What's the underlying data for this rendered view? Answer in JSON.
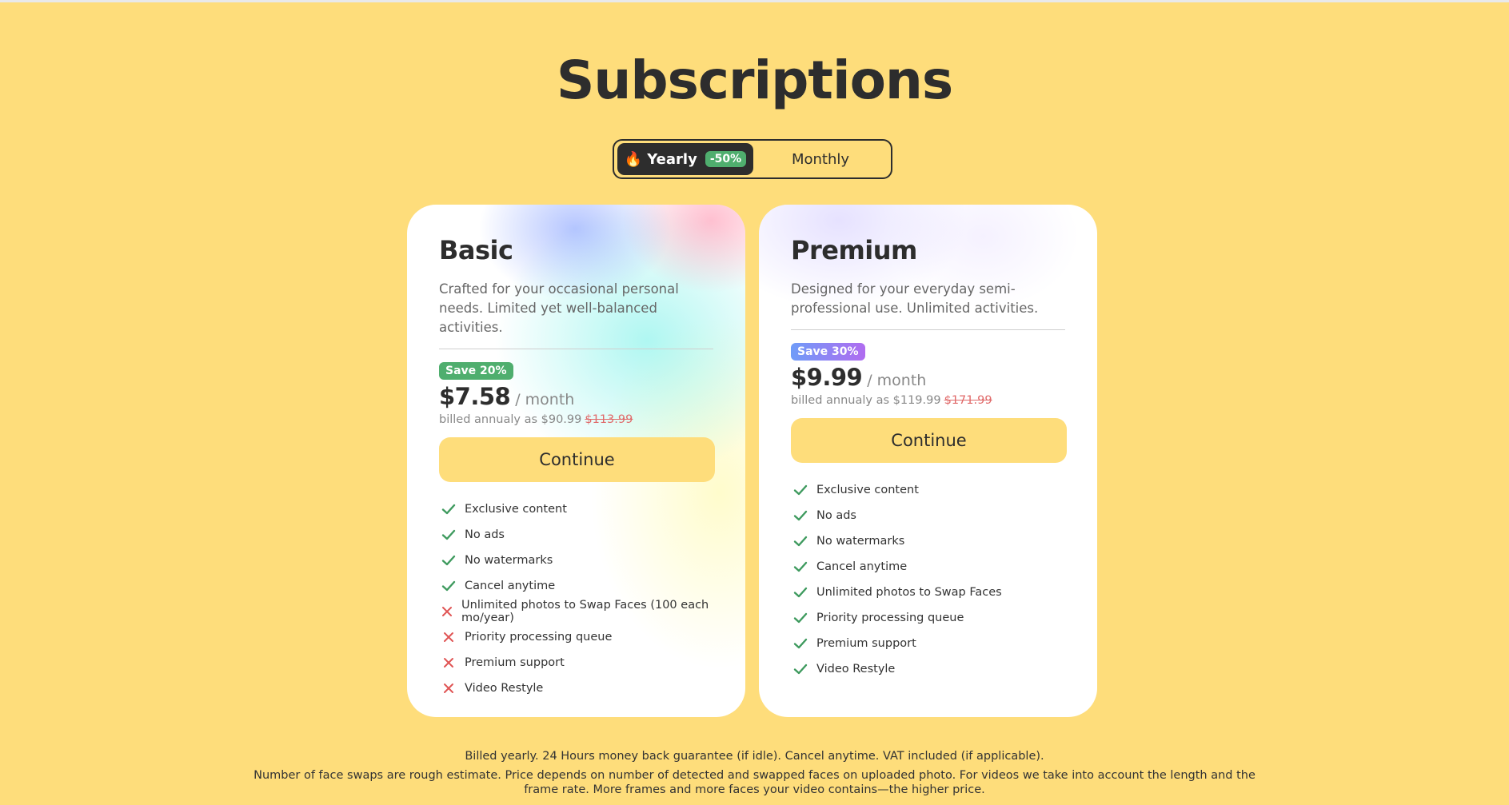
{
  "page": {
    "title": "Subscriptions"
  },
  "billing_toggle": {
    "yearly_icon": "fire-icon",
    "yearly_label": "Yearly",
    "yearly_discount": "-50%",
    "monthly_label": "Monthly",
    "selected": "Yearly"
  },
  "plans": [
    {
      "name": "Basic",
      "description": "Crafted for your occasional personal needs. Limited yet well-balanced activities.",
      "save_badge": "Save 20%",
      "price": "$7.58",
      "period": "/ month",
      "billed_text": "billed annualy as $90.99",
      "old_price": "$113.99",
      "cta": "Continue",
      "features": [
        {
          "label": "Exclusive content",
          "included": true
        },
        {
          "label": "No ads",
          "included": true
        },
        {
          "label": "No watermarks",
          "included": true
        },
        {
          "label": "Cancel anytime",
          "included": true
        },
        {
          "label": "Unlimited photos to Swap Faces (100 each mo/year)",
          "included": false
        },
        {
          "label": "Priority processing queue",
          "included": false
        },
        {
          "label": "Premium support",
          "included": false
        },
        {
          "label": "Video Restyle",
          "included": false
        }
      ]
    },
    {
      "name": "Premium",
      "description": "Designed for your everyday semi-professional use. Unlimited activities.",
      "save_badge": "Save 30%",
      "price": "$9.99",
      "period": "/ month",
      "billed_text": "billed annualy as $119.99",
      "old_price": "$171.99",
      "cta": "Continue",
      "features": [
        {
          "label": "Exclusive content",
          "included": true
        },
        {
          "label": "No ads",
          "included": true
        },
        {
          "label": "No watermarks",
          "included": true
        },
        {
          "label": "Cancel anytime",
          "included": true
        },
        {
          "label": "Unlimited photos to Swap Faces",
          "included": true
        },
        {
          "label": "Priority processing queue",
          "included": true
        },
        {
          "label": "Premium support",
          "included": true
        },
        {
          "label": "Video Restyle",
          "included": true
        }
      ]
    }
  ],
  "footer": {
    "line1": "Billed yearly. 24 Hours money back guarantee (if idle). Cancel anytime. VAT included (if applicable).",
    "line2": "Number of face swaps are rough estimate. Price depends on number of detected and swapped faces on uploaded photo. For videos we take into account the length and the frame rate. More frames and more faces your video contains—the higher price."
  },
  "colors": {
    "background": "#FEDD7B",
    "accent_dark": "#2D2D2D",
    "check_green": "#3E9A5E",
    "cross_red": "#E05555",
    "badge_green": "#4FAE6E"
  }
}
